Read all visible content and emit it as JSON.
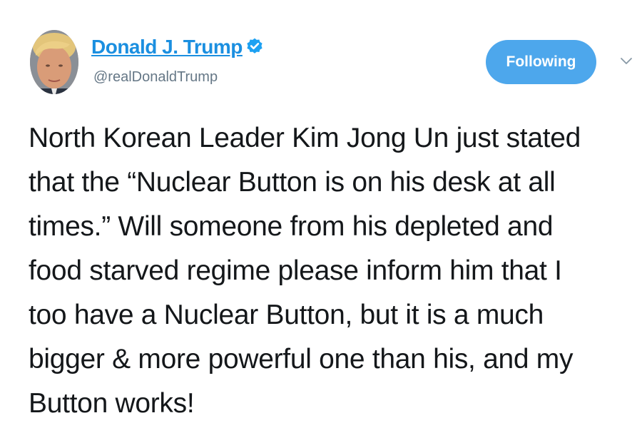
{
  "tweet": {
    "author": {
      "name": "Donald J. Trump",
      "handle": "@realDonaldTrump",
      "verified": true,
      "avatar": "profile-photo"
    },
    "follow_button_label": "Following",
    "menu_icon": "chevron-down-icon",
    "text_lines": [
      "North Korean Leader Kim Jong Un just stated",
      "that the “Nuclear Button is on his desk at all",
      "times.” Will someone from his depleted and",
      "food starved regime please inform him that I",
      "too have a Nuclear Button, but it is a much",
      "bigger & more powerful one than his, and my",
      "Button works!"
    ]
  },
  "colors": {
    "link": "#1b8fe0",
    "follow_button": "#4da7ec",
    "handle": "#657786",
    "text": "#14171a",
    "verified_badge": "#1da1f2"
  }
}
